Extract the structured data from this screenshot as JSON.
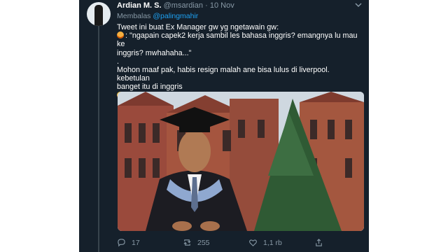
{
  "tweet": {
    "display_name": "Ardian M. S.",
    "handle": "@msardian",
    "separator": "·",
    "date": "10 Nov",
    "reply_prefix": "Membalas",
    "reply_handle": "@palingmahir",
    "lines": {
      "l1": "Tweet ini buat Ex Manager gw yg ngetawain gw:",
      "l2": ": \"ngapain capek2 kerja sambil les bahasa inggris? emangnya lu mau ke",
      "l3": "inggris? mwhahaha...\"",
      "l4": ".",
      "l5": "Mohon maaf pak, habis resign malah ane bisa lulus di liverpool. kebetulan",
      "l6": "banget itu di inggris"
    }
  },
  "photo": {
    "subject": "graduate in cap and gown in front of a red-brick gothic building"
  },
  "actions": {
    "reply_count": "17",
    "retweet_count": "255",
    "like_count": "1,1 rb"
  },
  "icons": {
    "reply": "reply-icon",
    "retweet": "retweet-icon",
    "like": "heart-icon",
    "share": "share-icon",
    "more": "chevron-down-icon"
  },
  "colors": {
    "background": "#15202b",
    "text": "#ffffff",
    "muted": "#8899a6",
    "link": "#1da1f2"
  }
}
